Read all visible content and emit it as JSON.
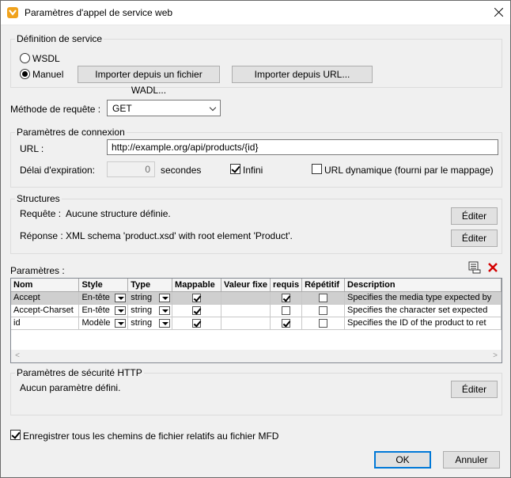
{
  "window": {
    "title": "Paramètres d'appel de service web"
  },
  "service_definition": {
    "legend": "Définition de service",
    "wsdl_label": "WSDL",
    "manual_label": "Manuel",
    "selected": "manual",
    "import_wadl_button": "Importer depuis un fichier WADL...",
    "import_url_button": "Importer depuis URL..."
  },
  "request_method": {
    "label": "Méthode de requête :",
    "value": "GET"
  },
  "connection": {
    "legend": "Paramètres de connexion",
    "url_label": "URL :",
    "url_value": "http://example.org/api/products/{id}",
    "timeout_label": "Délai d'expiration:",
    "timeout_value": "0",
    "timeout_unit": "secondes",
    "infinite_label": "Infini",
    "infinite_checked": true,
    "dynamic_url_label": "URL dynamique (fourni par le mappage)",
    "dynamic_url_checked": false
  },
  "structures": {
    "legend": "Structures",
    "request_label": "Requête :",
    "request_value": "Aucune structure définie.",
    "response_label": "Réponse :",
    "response_value": "XML schema 'product.xsd' with root element 'Product'.",
    "edit_button": "Éditer"
  },
  "parameters": {
    "label": "Paramètres :",
    "add_icon": "add-parameter-icon",
    "delete_icon": "delete-icon",
    "columns": [
      "Nom",
      "Style",
      "Type",
      "Mappable",
      "Valeur fixe",
      "requis",
      "Répétitif",
      "Description"
    ],
    "rows": [
      {
        "name": "Accept",
        "style": "En-tête",
        "type": "string",
        "mappable": true,
        "fixed": "",
        "required": true,
        "repeating": false,
        "description": "Specifies the media type expected by"
      },
      {
        "name": "Accept-Charset",
        "style": "En-tête",
        "type": "string",
        "mappable": true,
        "fixed": "",
        "required": false,
        "repeating": false,
        "description": "Specifies the character set expected"
      },
      {
        "name": "id",
        "style": "Modèle",
        "type": "string",
        "mappable": true,
        "fixed": "",
        "required": true,
        "repeating": false,
        "description": "Specifies the ID of the product to ret"
      }
    ]
  },
  "http_security": {
    "legend": "Paramètres de sécurité HTTP",
    "value": "Aucun paramètre défini.",
    "edit_button": "Éditer"
  },
  "relative_paths": {
    "label": "Enregistrer tous les chemins de fichier relatifs au fichier MFD",
    "checked": true
  },
  "buttons": {
    "ok": "OK",
    "cancel": "Annuler"
  },
  "colors": {
    "accent": "#0078d7",
    "delete_red": "#d40000",
    "app_icon": "#f0a21c"
  }
}
